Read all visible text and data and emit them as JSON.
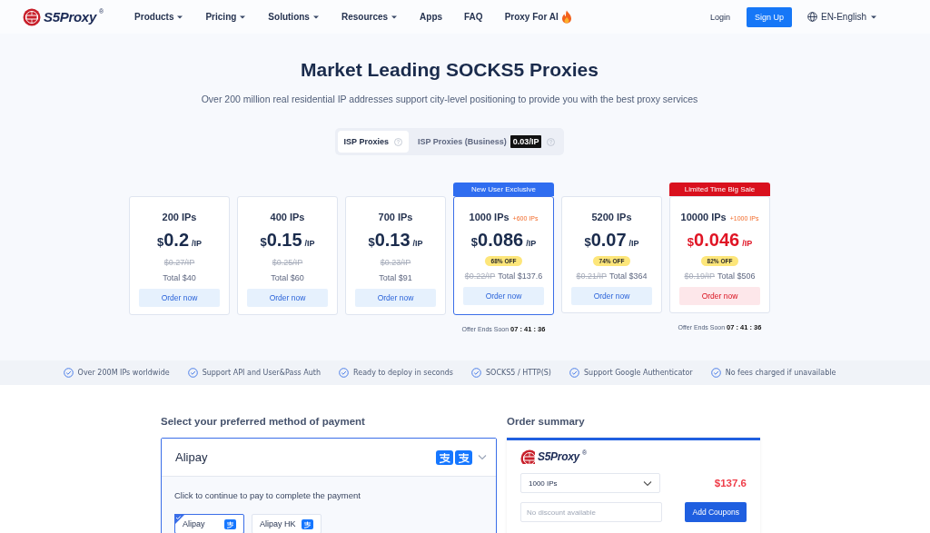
{
  "nav": {
    "brand": "S5Proxy",
    "registered": "®",
    "menu": [
      {
        "label": "Products",
        "kind": "dropdown"
      },
      {
        "label": "Pricing",
        "kind": "dropdown"
      },
      {
        "label": "Solutions",
        "kind": "dropdown"
      },
      {
        "label": "Resources",
        "kind": "dropdown"
      },
      {
        "label": "Apps",
        "kind": "link"
      },
      {
        "label": "FAQ",
        "kind": "link"
      },
      {
        "label": "Proxy For AI",
        "kind": "hot"
      }
    ],
    "login": "Login",
    "signup": "Sign Up",
    "language": "EN-English"
  },
  "hero": {
    "title": "Market Leading SOCKS5 Proxies",
    "subtitle": "Over 200 million real residential IP addresses support city-level positioning to provide you with the best proxy services"
  },
  "tabs": [
    {
      "label": "ISP Proxies",
      "selected": true
    },
    {
      "label": "ISP Proxies (Business)",
      "selected": false,
      "badge": "0.03/IP"
    }
  ],
  "plans": [
    {
      "kind": "plain",
      "ips": "200 IPs",
      "currency": "$",
      "price": "0.2",
      "unit": "/IP",
      "old_price": "$0.27/IP",
      "total": "Total $40",
      "button": "Order now"
    },
    {
      "kind": "plain",
      "ips": "400 IPs",
      "currency": "$",
      "price": "0.15",
      "unit": "/IP",
      "old_price": "$0.25/IP",
      "total": "Total $60",
      "button": "Order now"
    },
    {
      "kind": "plain",
      "ips": "700 IPs",
      "currency": "$",
      "price": "0.13",
      "unit": "/IP",
      "old_price": "$0.23/IP",
      "total": "Total $91",
      "button": "Order now"
    },
    {
      "kind": "featured",
      "ribbon": "New User Exclusive",
      "ips": "1000 IPs",
      "bonus": "+600 IPs",
      "currency": "$",
      "price": "0.086",
      "unit": "/IP",
      "discount": "68% OFF",
      "old_price": "$0.22/IP",
      "total": "Total $137.6",
      "button": "Order now",
      "countdown_label": "Offer Ends Soon",
      "countdown": "07 : 41 : 36"
    },
    {
      "kind": "plain",
      "ips": "5200 IPs",
      "currency": "$",
      "price": "0.07",
      "unit": "/IP",
      "discount": "74% OFF",
      "old_price": "$0.21/IP",
      "total": "Total $364",
      "button": "Order now"
    },
    {
      "kind": "sale",
      "ribbon": "Limited Time Big Sale",
      "ips": "10000 IPs",
      "bonus": "+1000 IPs",
      "currency": "$",
      "price": "0.046",
      "unit": "/IP",
      "discount": "82% OFF",
      "old_price": "$0.19/IP",
      "total": "Total $506",
      "button": "Order now",
      "countdown_label": "Offer Ends Soon",
      "countdown": "07 : 41 : 36"
    }
  ],
  "features": [
    "Over 200M IPs worldwide",
    "Support API and User&Pass Auth",
    "Ready to deploy in seconds",
    "SOCKS5 / HTTP(S)",
    "Support Google Authenticator",
    "No fees charged if unavailable"
  ],
  "payment": {
    "heading": "Select your preferred method of payment",
    "method": "Alipay",
    "note": "Click to continue to pay to complete the payment",
    "options": [
      {
        "label": "Alipay",
        "selected": true
      },
      {
        "label": "Alipay HK",
        "selected": false
      }
    ]
  },
  "summary": {
    "heading": "Order summary",
    "brand": "S5Proxy",
    "registered": "®",
    "package": "1000 IPs",
    "amount": "$137.6",
    "coupon_placeholder": "No discount available",
    "coupon_button": "Add Coupons"
  }
}
